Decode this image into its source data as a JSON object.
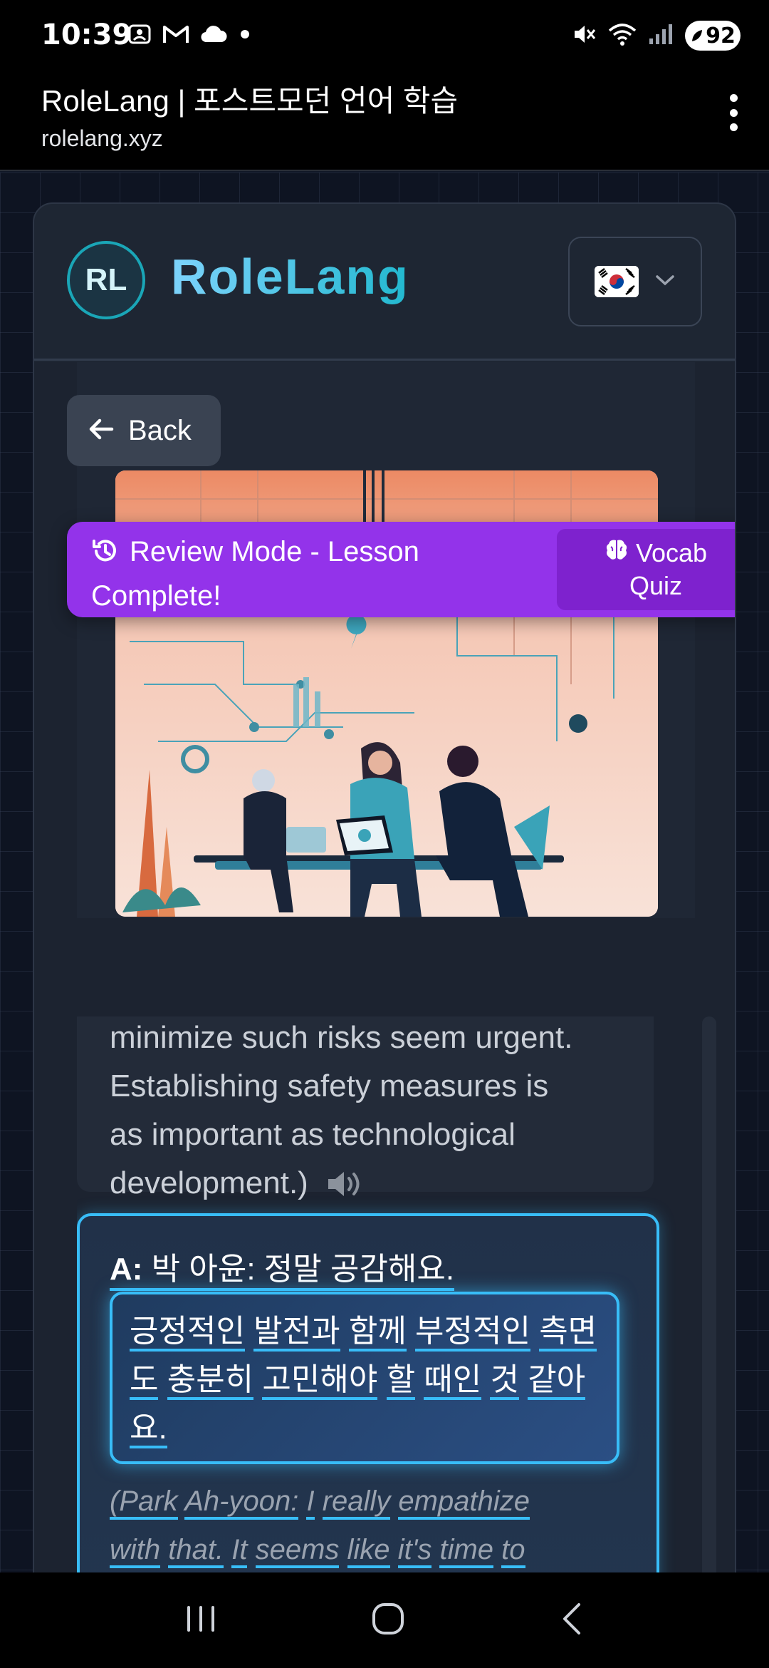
{
  "status_bar": {
    "time": "10:39",
    "battery": "92",
    "left_icons": [
      "screenshot-icon",
      "gmail-icon",
      "cloud-icon",
      "dot-icon"
    ],
    "right_icons": [
      "mute-icon",
      "wifi-icon",
      "signal-icon"
    ]
  },
  "browser": {
    "title": "RoleLang | 포스트모던 언어 학습",
    "url": "rolelang.xyz"
  },
  "app": {
    "logo_initials": "RL",
    "logo_name": "RoleLang",
    "language_flag": "south-korea-flag",
    "colors": {
      "accent": "#38bdf8",
      "banner": "#9333ea",
      "banner_button": "#7e22ce"
    }
  },
  "lesson": {
    "back_label": "Back",
    "review_banner": "Review Mode - Lesson Complete!",
    "quiz_button_line1": "Vocab",
    "quiz_button_line2": "Quiz",
    "previous_message": {
      "line1": "minimize such risks seem urgent.",
      "line2": "Establishing safety measures is",
      "line3": "as important as technological",
      "line4": "development.)"
    },
    "message": {
      "speaker_tag": "A:",
      "speaker_line": "박 아윤: 정말 공감해요.",
      "korean_words": [
        "긍정적인",
        "발전과",
        "함께",
        "부정적인",
        "측면",
        "도",
        "충분히",
        "고민해야",
        "할",
        "때인",
        "것",
        "같아",
        "요."
      ],
      "translation_words": [
        "(Park",
        "Ah-yoon:",
        "I",
        "really",
        "empathize",
        "with",
        "that.",
        "It",
        "seems",
        "like",
        "it's",
        "time",
        "to"
      ]
    }
  }
}
